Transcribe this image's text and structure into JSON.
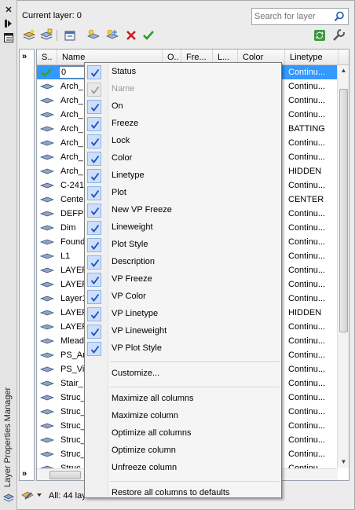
{
  "palette": {
    "title": "Layer Properties Manager",
    "close_glyph": "✕"
  },
  "header": {
    "current_layer": "Current layer: 0",
    "search_placeholder": "Search for layer"
  },
  "toolbar": {
    "icons": [
      "new-property-filter-icon",
      "new-group-filter-icon",
      "layer-states-manager-icon",
      "new-layer-icon",
      "new-layer-vp-frozen-icon",
      "delete-layer-icon",
      "set-current-icon",
      "refresh-icon",
      "settings-icon"
    ]
  },
  "tree": {
    "expand_glyph": "»"
  },
  "list": {
    "columns": [
      "S..",
      "Name",
      "O..",
      "Fre...",
      "L...",
      "Color",
      "Linetype"
    ],
    "rows": [
      {
        "name": "0",
        "linetype": "Continu...",
        "selected": true,
        "current": true
      },
      {
        "name": "Arch_",
        "linetype": "Continu..."
      },
      {
        "name": "Arch_",
        "linetype": "Continu..."
      },
      {
        "name": "Arch_",
        "linetype": "Continu..."
      },
      {
        "name": "Arch_",
        "linetype": "BATTING"
      },
      {
        "name": "Arch_",
        "linetype": "Continu..."
      },
      {
        "name": "Arch_",
        "linetype": "Continu..."
      },
      {
        "name": "Arch_",
        "linetype": "HIDDEN"
      },
      {
        "name": "C-241",
        "linetype": "Continu..."
      },
      {
        "name": "Cente",
        "linetype": "CENTER"
      },
      {
        "name": "DEFPO",
        "linetype": "Continu..."
      },
      {
        "name": "Dim",
        "linetype": "Continu..."
      },
      {
        "name": "Found",
        "linetype": "Continu..."
      },
      {
        "name": "L1",
        "linetype": "Continu..."
      },
      {
        "name": "LAYER",
        "linetype": "Continu..."
      },
      {
        "name": "LAYER",
        "linetype": "Continu..."
      },
      {
        "name": "Layer1",
        "linetype": "Continu..."
      },
      {
        "name": "LAYER",
        "linetype": "HIDDEN"
      },
      {
        "name": "LAYER",
        "linetype": "Continu..."
      },
      {
        "name": "Mlead",
        "linetype": "Continu..."
      },
      {
        "name": "PS_Ar",
        "linetype": "Continu..."
      },
      {
        "name": "PS_Vie",
        "linetype": "Continu..."
      },
      {
        "name": "Stair_",
        "linetype": "Continu..."
      },
      {
        "name": "Struc_",
        "linetype": "Continu..."
      },
      {
        "name": "Struc_",
        "linetype": "Continu..."
      },
      {
        "name": "Struc_",
        "linetype": "Continu..."
      },
      {
        "name": "Struc_",
        "linetype": "Continu..."
      },
      {
        "name": "Struc_",
        "linetype": "Continu..."
      },
      {
        "name": "Struc_",
        "linetype": "Continu..."
      }
    ]
  },
  "status": {
    "text": "All: 44 lay"
  },
  "menu": {
    "checked_items": [
      {
        "label": "Status",
        "disabled": false
      },
      {
        "label": "Name",
        "disabled": true
      },
      {
        "label": "On",
        "disabled": false
      },
      {
        "label": "Freeze",
        "disabled": false
      },
      {
        "label": "Lock",
        "disabled": false
      },
      {
        "label": "Color",
        "disabled": false
      },
      {
        "label": "Linetype",
        "disabled": false
      },
      {
        "label": "Plot",
        "disabled": false
      },
      {
        "label": "New VP Freeze",
        "disabled": false
      },
      {
        "label": "Lineweight",
        "disabled": false
      },
      {
        "label": "Plot Style",
        "disabled": false
      },
      {
        "label": "Description",
        "disabled": false
      },
      {
        "label": "VP Freeze",
        "disabled": false
      },
      {
        "label": "VP Color",
        "disabled": false
      },
      {
        "label": "VP Linetype",
        "disabled": false
      },
      {
        "label": "VP Lineweight",
        "disabled": false
      },
      {
        "label": "VP Plot Style",
        "disabled": false
      }
    ],
    "customize": "Customize...",
    "column_actions": [
      "Maximize all columns",
      "Maximize column",
      "Optimize all columns",
      "Optimize column",
      "Unfreeze column"
    ],
    "restore": "Restore all columns to defaults"
  },
  "colors": {
    "selection": "#3399ff",
    "check": "#1f4fa8",
    "current_check": "#2fa52f"
  }
}
